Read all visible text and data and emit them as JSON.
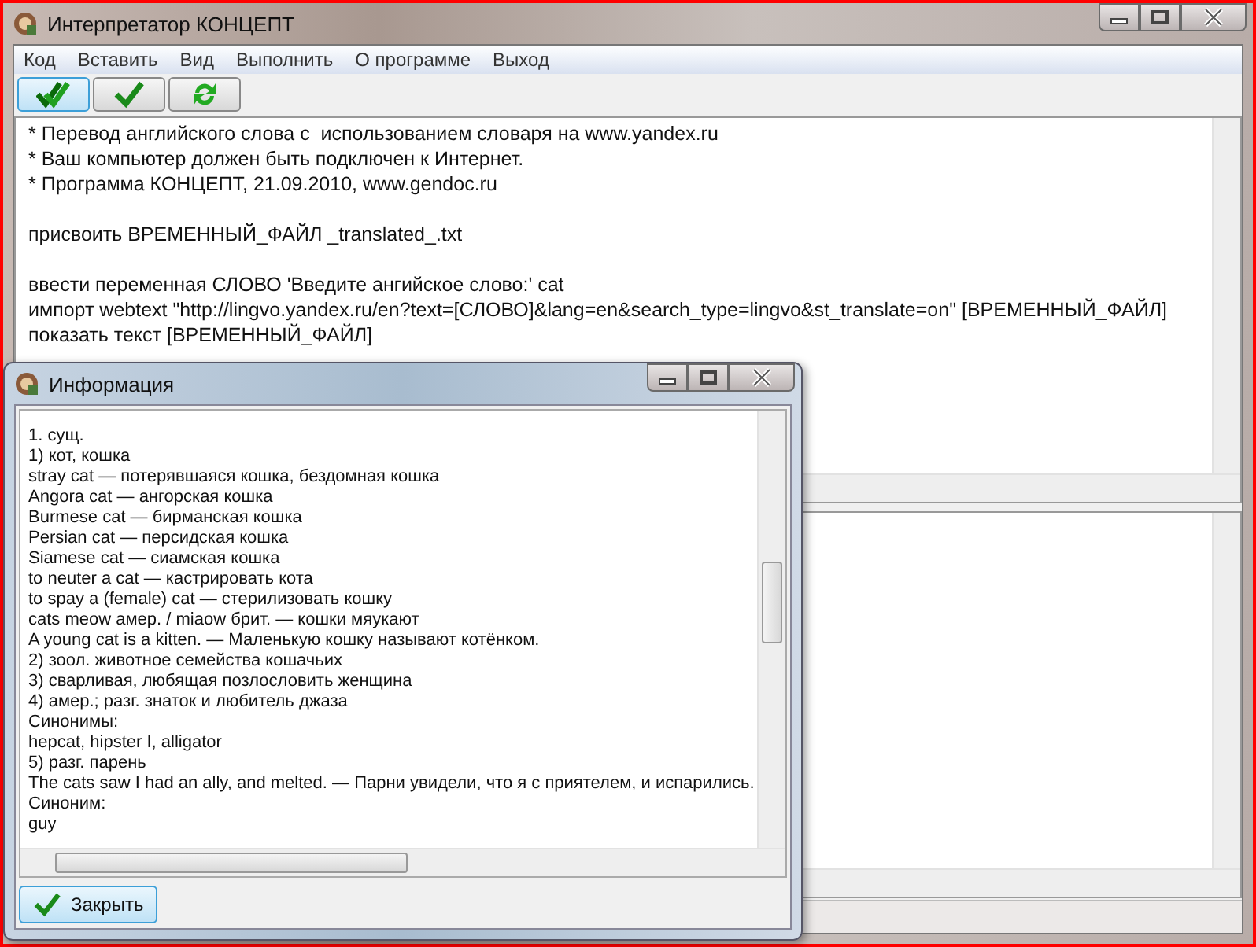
{
  "window": {
    "title": "Интерпретатор КОНЦЕПТ"
  },
  "menu": [
    "Код",
    "Вставить",
    "Вид",
    "Выполнить",
    "О программе",
    "Выход"
  ],
  "toolbar": [
    {
      "kind": "double-check",
      "selected": true
    },
    {
      "kind": "check",
      "selected": false
    },
    {
      "kind": "refresh",
      "selected": false
    }
  ],
  "editor": {
    "blocks": [
      [
        "* Перевод английского слова с  использованием словаря на www.yandex.ru",
        "* Ваш компьютер должен быть подключен к Интернет.",
        "* Программа КОНЦЕПТ, 21.09.2010, www.gendoc.ru"
      ],
      [
        "присвоить ВРЕМЕННЫЙ_ФАЙЛ _translated_.txt"
      ],
      [
        "ввести переменная СЛОВО 'Введите ангийское слово:' cat",
        "импорт webtext \"http://lingvo.yandex.ru/en?text=[СЛОВО]&lang=en&search_type=lingvo&st_translate=on\" [ВРЕМЕННЫЙ_ФАЙЛ]",
        "показать текст [ВРЕМЕННЫЙ_ФАЙЛ]"
      ]
    ]
  },
  "dialog": {
    "title": "Информация",
    "lines": [
      "1. сущ.",
      "1) кот, кошка",
      "stray cat — потерявшаяся кошка, бездомная кошка",
      "Angora cat — ангорская кошка",
      "Burmese cat — бирманская кошка",
      "Persian cat — персидская кошка",
      "Siamese cat — сиамская кошка",
      "to neuter a cat — кастрировать кота",
      "to spay a (female) cat — стерилизовать кошку",
      "cats meow амер. / miaow брит. — кошки мяукают",
      "A young cat is a kitten. — Маленькую кошку называют котёнком.",
      "2) зоол. животное семейства кошачьих",
      "3) сварливая, любящая позлословить женщина",
      "4) амер.; разг. знаток и любитель джаза",
      "Синонимы:",
      "hepcat, hipster I, alligator",
      "5) разг. парень",
      "The cats saw I had an ally, and melted. — Парни увидели, что я с приятелем, и испарились.",
      "Синоним:",
      "guy"
    ],
    "close_button": "Закрыть"
  }
}
